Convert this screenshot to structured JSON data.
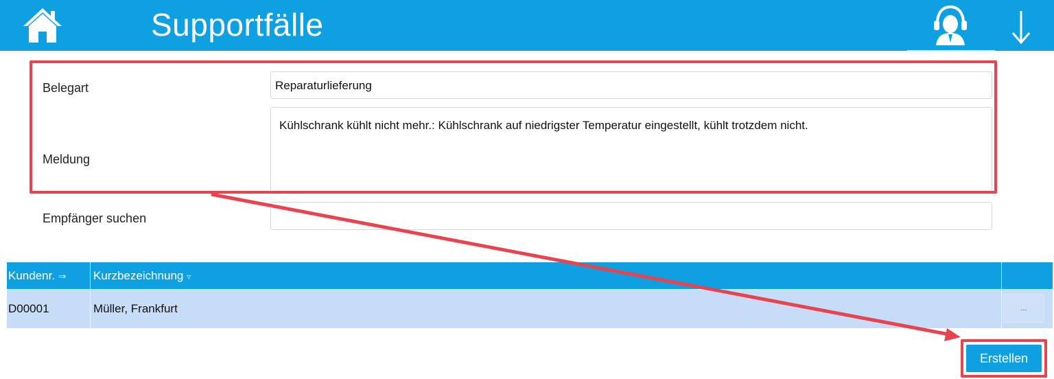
{
  "header": {
    "title": "Supportfälle",
    "home_icon": "home-icon",
    "support_icon": "support-agent-icon",
    "download_icon": "arrow-down-icon",
    "bg_color": "#0fa0e2"
  },
  "form": {
    "belegart_label": "Belegart",
    "belegart_value": "Reparaturlieferung",
    "meldung_label": "Meldung",
    "meldung_value": "Kühlschrank kühlt nicht mehr.: Kühlschrank auf niedrigster Temperatur eingestellt, kühlt trotzdem nicht.",
    "empfaenger_label": "Empfänger suchen",
    "empfaenger_value": ""
  },
  "table": {
    "columns": [
      "Kundenr.",
      "Kurzbezeichnung"
    ],
    "rows": [
      {
        "kundennr": "D00001",
        "kurzbezeichnung": "Müller, Frankfurt",
        "action": "..."
      }
    ]
  },
  "actions": {
    "create_label": "Erstellen"
  },
  "annotation_color": "#e8434e"
}
